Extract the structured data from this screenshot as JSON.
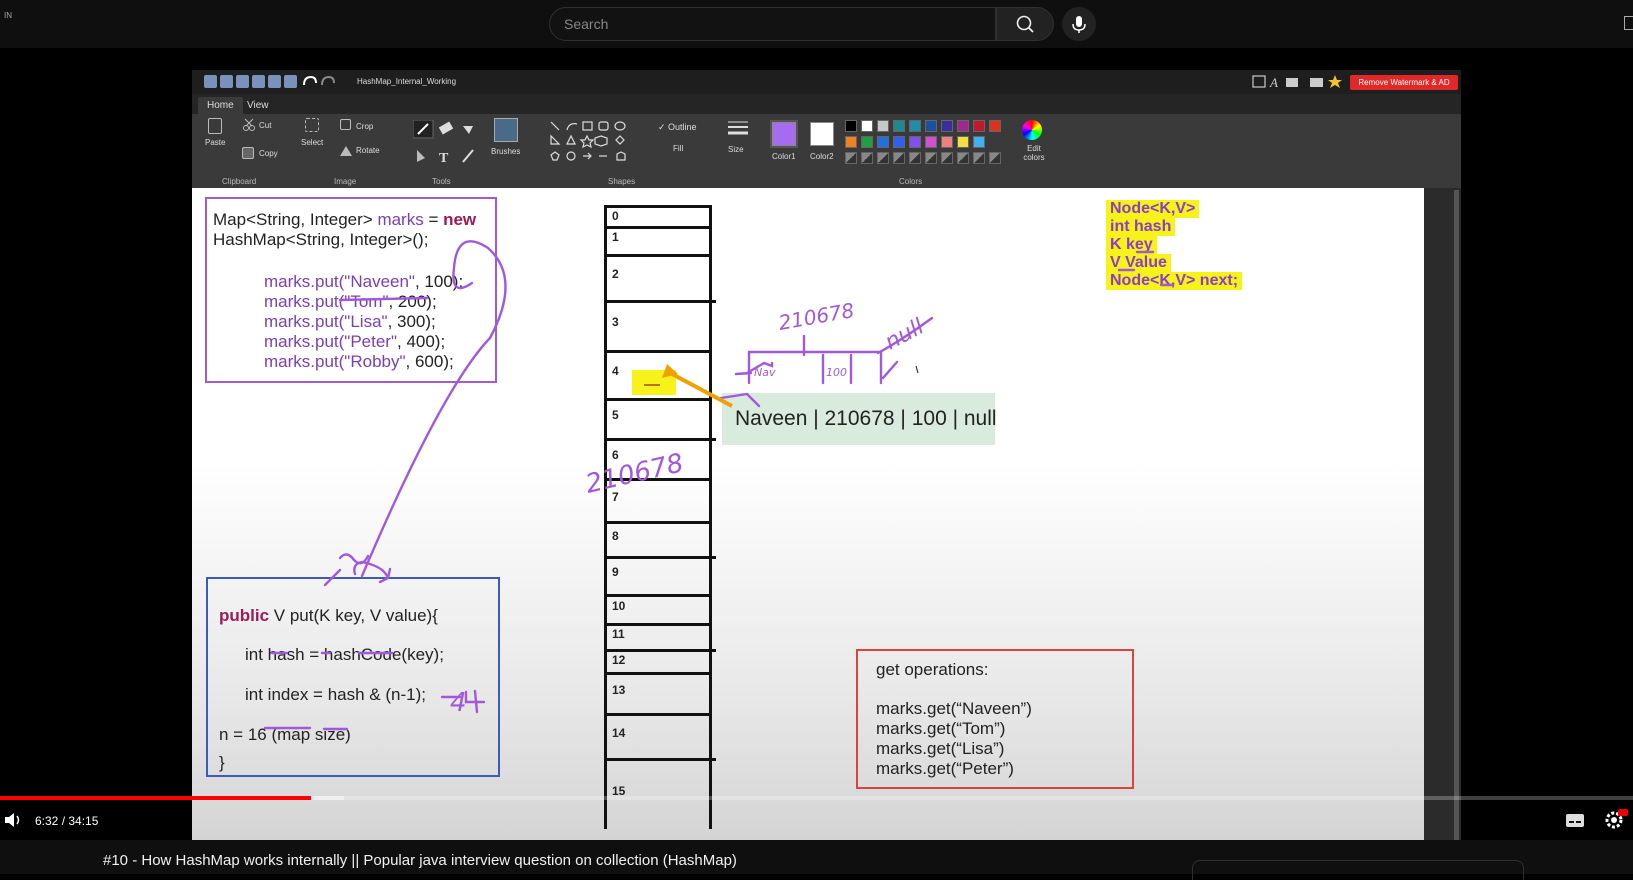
{
  "youtube": {
    "region": "IN",
    "search_placeholder": "Search",
    "video_title": "#10 - How HashMap works internally || Popular java interview question on collection (HashMap)",
    "time": "6:32 / 34:15",
    "progress": 0.1904
  },
  "paint": {
    "doc_title": "HashMap_Internal_Working",
    "remove_watermark": "Remove Watermark & AD",
    "tabs": [
      "Home",
      "View"
    ],
    "ribbon": {
      "paste": "Paste",
      "cut": "Cut",
      "copy": "Copy",
      "select": "Select",
      "crop": "Crop",
      "rotate": "Rotate",
      "brushes": "Brushes",
      "outline": "Outline",
      "fill": "Fill",
      "size": "Size",
      "color1": "Color1",
      "color2": "Color2",
      "edit_colors": "Edit colors",
      "groups": [
        "Clipboard",
        "Image",
        "Tools",
        "Shapes",
        "Colors"
      ]
    },
    "palette": [
      "#000000",
      "#ffffff",
      "#c8c8c8",
      "#1f8a8a",
      "#1e8fa6",
      "#1f4fa0",
      "#3b2fa0",
      "#a02890",
      "#c01830",
      "#e03020",
      "#f08020",
      "#20a040",
      "#2070e0",
      "#3060f0",
      "#8050f0",
      "#d050d0",
      "#f08080",
      "#f0e040",
      "#40b0f0"
    ],
    "color1": "#a76bf2",
    "color2": "#ffffff"
  },
  "slide": {
    "code_box_1": {
      "line1_a": "Map<String, Integer> ",
      "line1_b": "marks",
      "line1_c": " = ",
      "line1_d": "new",
      "line2": "HashMap<String, Integer>();",
      "puts": [
        {
          "key": "\"Naveen\"",
          "rest": ", 100);"
        },
        {
          "key": "\"Tom\"",
          "rest": ", 200);"
        },
        {
          "key": "\"Lisa\"",
          "rest": ", 300);"
        },
        {
          "key": "\"Peter\"",
          "rest": ", 400);"
        },
        {
          "key": "\"Robby\"",
          "rest": ", 600);"
        }
      ],
      "put_prefix": "marks.put("
    },
    "code_box_2": {
      "kw": "public",
      "sig": " V put(K key, V value){",
      "line2": "int hash = hashCode(key);",
      "line3": "int index = hash & (n-1);",
      "line4": "n = 16 (map size)",
      "line5": "}"
    },
    "handwritten": {
      "hash_value": "210678",
      "hash_value_top": "210678",
      "index_note": "4",
      "null_note": "null",
      "node_box_a": "Nav",
      "node_box_b": "100"
    },
    "buckets": [
      "0",
      "1",
      "2",
      "3",
      "4",
      "5",
      "6",
      "7",
      "8",
      "9",
      "10",
      "11",
      "12",
      "13",
      "14",
      "15"
    ],
    "node_label": "Naveen | 210678 | 100 | null",
    "node_class": [
      "Node<K,V>",
      "int hash",
      "K key",
      "V Value",
      "Node<K,V> next;"
    ],
    "get_ops": {
      "title": "get operations:",
      "lines": [
        "marks.get(“Naveen”)",
        "marks.get(“Tom”)",
        "marks.get(“Lisa”)",
        "marks.get(“Peter”)"
      ]
    }
  }
}
